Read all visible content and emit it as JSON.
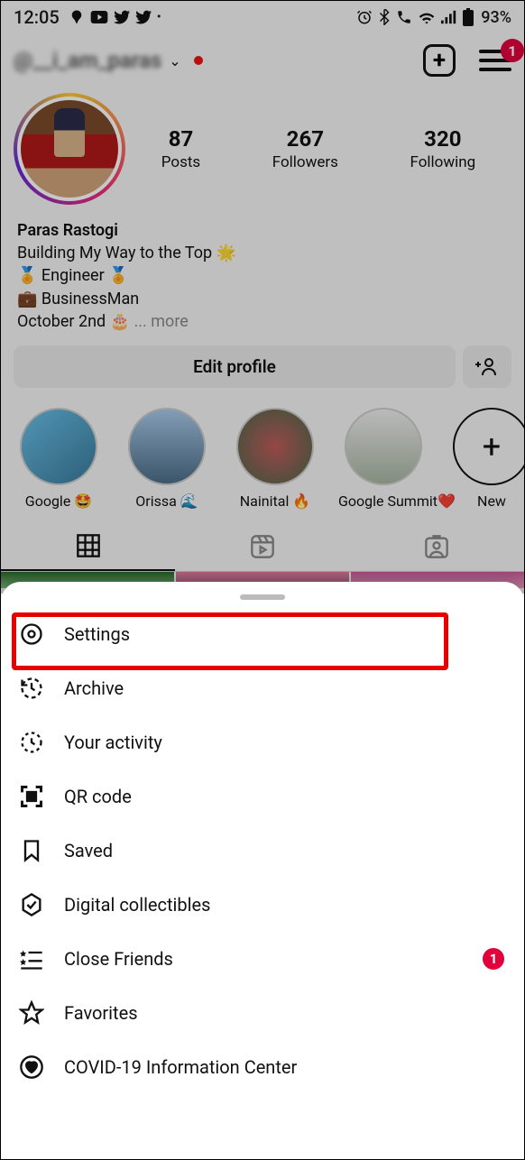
{
  "status_bar": {
    "time": "12:05",
    "battery": "93%"
  },
  "header": {
    "username": "@__i_am_paras",
    "menu_badge": "1"
  },
  "stats": {
    "posts_count": "87",
    "posts_label": "Posts",
    "followers_count": "267",
    "followers_label": "Followers",
    "following_count": "320",
    "following_label": "Following"
  },
  "bio": {
    "name": "Paras Rastogi",
    "line1": "Building My Way to the Top 🌟",
    "line2": "🏅 Engineer 🏅",
    "line3": "💼 BusinessMan",
    "line4": "October 2nd 🎂",
    "more": "... more"
  },
  "edit_profile_label": "Edit profile",
  "highlights": [
    {
      "label": "Google 🤩"
    },
    {
      "label": "Orissa 🌊"
    },
    {
      "label": "Nainital 🔥"
    },
    {
      "label": "Google Summit❤️"
    }
  ],
  "highlight_new_label": "New",
  "menu": {
    "settings": "Settings",
    "archive": "Archive",
    "activity": "Your activity",
    "qr": "QR code",
    "saved": "Saved",
    "collectibles": "Digital collectibles",
    "close_friends": "Close Friends",
    "close_friends_badge": "1",
    "favorites": "Favorites",
    "covid": "COVID-19 Information Center"
  }
}
